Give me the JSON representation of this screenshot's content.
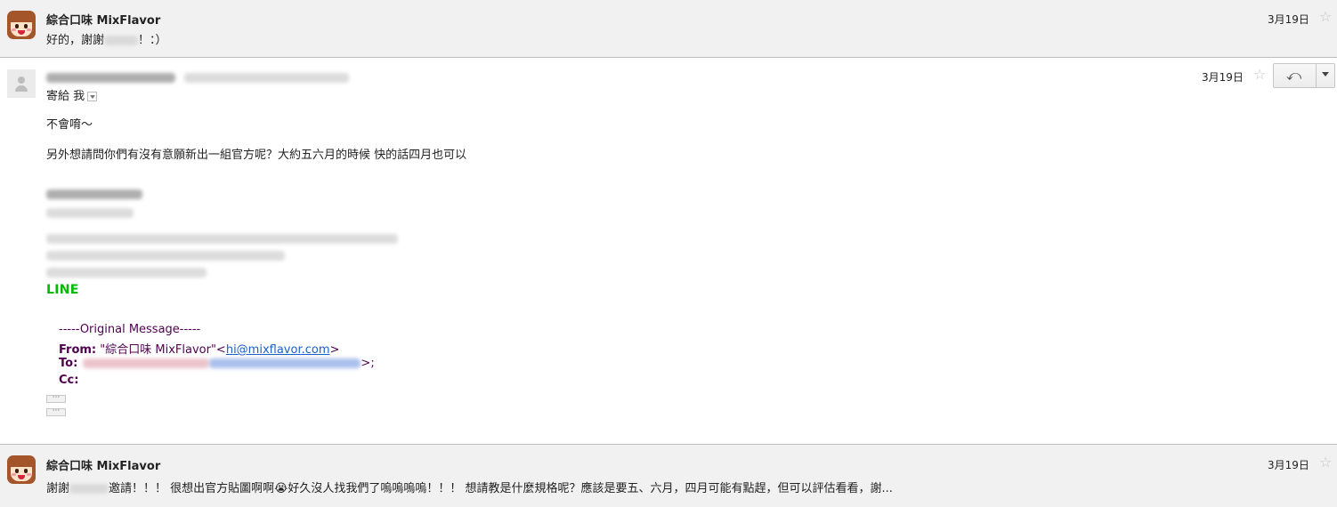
{
  "messages": [
    {
      "sender": "綜合口味 MixFlavor",
      "snippet_prefix": "好的，謝謝",
      "snippet_suffix": "！：）",
      "date": "3月19日"
    },
    {
      "to_label": "寄給",
      "to_value": "我",
      "date": "3月19日",
      "body_lines": [
        "不會唷～",
        "另外想請問你們有沒有意願新出一組官方呢？大約五六月的時候  快的話四月也可以"
      ],
      "logo_text": "LINE",
      "original": {
        "header": "-----Original Message-----",
        "from_label": "From:",
        "from_name": " \"綜合口味 MixFlavor\"<",
        "from_email": "hi@mixflavor.com",
        "from_end": ">",
        "to_label": "To:",
        "to_end": ">;",
        "cc_label": "Cc:"
      },
      "ellipsis": "···"
    },
    {
      "sender": "綜合口味 MixFlavor",
      "snippet_prefix": "謝謝",
      "snippet_suffix": "邀請！！！ 很想出官方貼圖啊啊😭好久沒人找我們了嗚嗚嗚嗚！！！ 想請教是什麼規格呢？應該是要五、六月，四月可能有點趕，但可以評估看看，謝...",
      "date": "3月19日"
    }
  ],
  "icons": {
    "star": "☆",
    "reply": "⤺"
  },
  "colors": {
    "line_green": "#00b900",
    "quote_purple": "#500050",
    "link_blue": "#1a5fc7"
  }
}
